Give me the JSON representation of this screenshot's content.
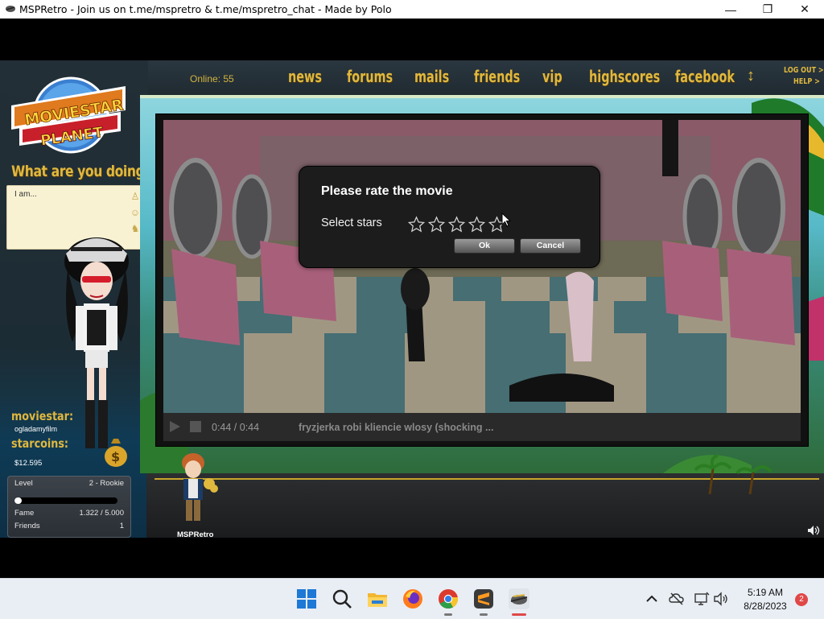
{
  "window": {
    "title": "MSPRetro - Join us on t.me/mspretro & t.me/mspretro_chat - Made by Polo",
    "minimize": "—",
    "maximize": "❐",
    "close": "✕"
  },
  "nav": {
    "online": "Online: 55",
    "links": [
      "news",
      "forums",
      "mails",
      "friends",
      "vip",
      "highscores",
      "facebook"
    ],
    "arrow": "↕",
    "logout": "LOG OUT >",
    "help": "HELP >"
  },
  "left": {
    "logo_line1": "MOVIESTAR",
    "logo_line2": "PLANET",
    "what_are_you_doing": "What are you doing?",
    "status_placeholder": "I am...",
    "moviestar_label": "moviestar:",
    "moviestar_name": "ogladamyfilm",
    "starcoins_label": "starcoins:",
    "starcoins_value": "$12.595",
    "stats": {
      "level_label": "Level",
      "level_value": "2 - Rookie",
      "level_progress": 0.07,
      "fame_label": "Fame",
      "fame_value": "1.322 / 5.000",
      "friends_label": "Friends",
      "friends_value": "1"
    }
  },
  "video": {
    "time": "0:44 / 0:44",
    "title": "fryzjerka robi kliencie wlosy (shocking ..."
  },
  "dialog": {
    "title": "Please rate the movie",
    "select_label": "Select stars",
    "stars_total": 5,
    "stars_selected": 0,
    "ok_label": "Ok",
    "cancel_label": "Cancel"
  },
  "chat": {
    "my_name": "MSPRetro"
  },
  "taskbar": {
    "icons": [
      "windows-start-icon",
      "search-icon",
      "file-explorer-icon",
      "firefox-icon",
      "chrome-icon",
      "sublime-icon",
      "mspretro-app-icon"
    ],
    "time": "5:19 AM",
    "date": "8/28/2023",
    "notifications": "2"
  },
  "colors": {
    "gold": "#e0b83e",
    "dialog_bg": "#1c1c1c",
    "taskbar_bg": "#e9eef5"
  }
}
